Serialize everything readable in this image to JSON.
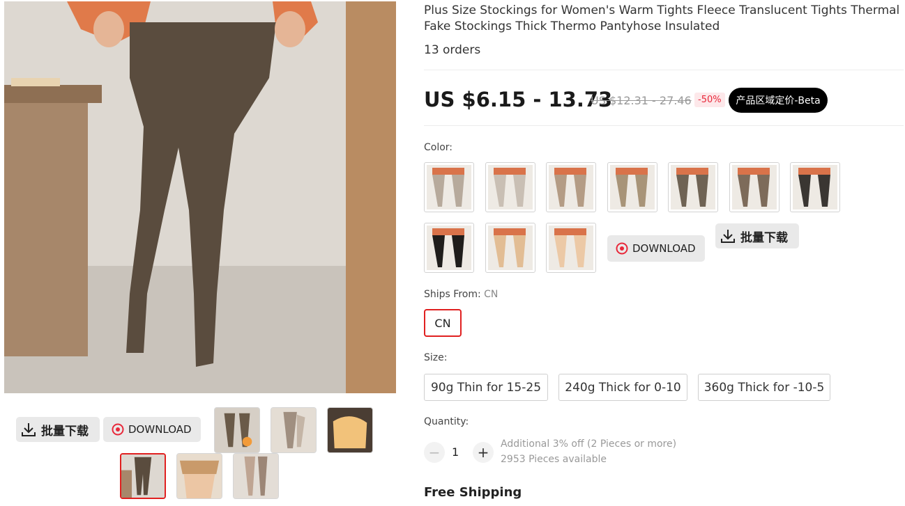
{
  "product": {
    "title": "Plus Size Stockings for Women's Warm Tights Fleece Translucent Tights Thermal Fake Stockings Thick Thermo Pantyhose Insulated",
    "orders": "13 orders"
  },
  "price": {
    "current": "US $6.15 - 13.73",
    "original": "US $12.31 - 27.46",
    "discount": "-50%",
    "beta_button": "产品区域定价-Beta"
  },
  "tools": {
    "batch_download": "批量下载",
    "download": "DOWNLOAD"
  },
  "color": {
    "label": "Color:",
    "swatches": [
      "grey tights",
      "light grey tights",
      "taupe tights",
      "khaki tights",
      "dark grey tights",
      "brown grey tights",
      "black tights",
      "black opaque tights",
      "nude tights",
      "light nude tights"
    ]
  },
  "ships_from": {
    "label": "Ships From:",
    "value": "CN",
    "option": "CN"
  },
  "size": {
    "label": "Size:",
    "options": [
      "90g Thin for 15-25",
      "240g Thick for 0-10",
      "360g Thick for -10-5"
    ]
  },
  "quantity": {
    "label": "Quantity:",
    "value": "1",
    "minus": "−",
    "plus": "+",
    "discount_note": "Additional 3% off (2 Pieces or more)",
    "available": "2953 Pieces available"
  },
  "shipping": {
    "label": "Free Shipping"
  },
  "colors": {
    "accent_red": "#e02020",
    "price_black": "#1a1a1a",
    "discount_bg": "#fde8ea"
  }
}
